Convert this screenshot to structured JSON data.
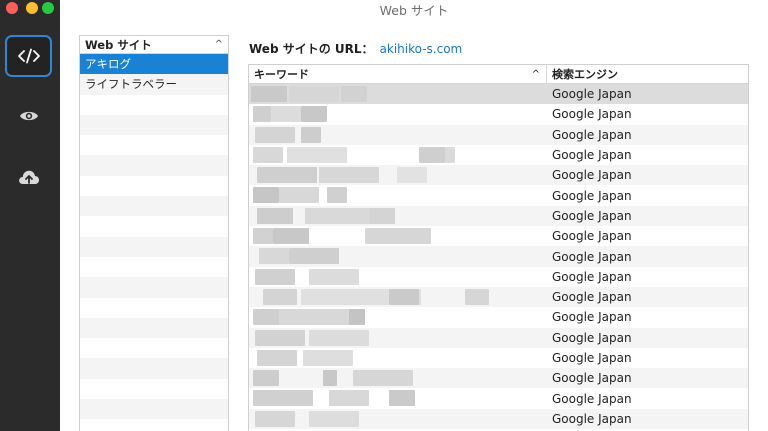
{
  "window": {
    "title": "Web サイト"
  },
  "sidebar": {
    "items": [
      {
        "icon": "code-icon",
        "active": true
      },
      {
        "icon": "eye-icon",
        "active": false
      },
      {
        "icon": "cloud-upload-icon",
        "active": false
      }
    ]
  },
  "site_list": {
    "header": "Web サイト",
    "sort_indicator": "^",
    "items": [
      {
        "label": "アキログ",
        "selected": true
      },
      {
        "label": "ライフトラベラー",
        "selected": false
      }
    ]
  },
  "url_line": {
    "label": "Web サイトの URL：",
    "value": "akihiko-s.com"
  },
  "keyword_table": {
    "columns": [
      {
        "label": "キーワード",
        "sort_indicator": "^"
      },
      {
        "label": "検索エンジン"
      }
    ],
    "rows": [
      {
        "engine": "Google Japan"
      },
      {
        "engine": "Google Japan"
      },
      {
        "engine": "Google Japan"
      },
      {
        "engine": "Google Japan"
      },
      {
        "engine": "Google Japan"
      },
      {
        "engine": "Google Japan"
      },
      {
        "engine": "Google Japan"
      },
      {
        "engine": "Google Japan"
      },
      {
        "engine": "Google Japan"
      },
      {
        "engine": "Google Japan"
      },
      {
        "engine": "Google Japan"
      },
      {
        "engine": "Google Japan"
      },
      {
        "engine": "Google Japan"
      },
      {
        "engine": "Google Japan"
      },
      {
        "engine": "Google Japan"
      },
      {
        "engine": "Google Japan"
      },
      {
        "engine": "Google Japan"
      }
    ]
  },
  "colors": {
    "sidebar_bg": "#2b2b2b",
    "accent": "#1a82d4",
    "link": "#1b77c4",
    "active_border": "#2f86d6"
  }
}
